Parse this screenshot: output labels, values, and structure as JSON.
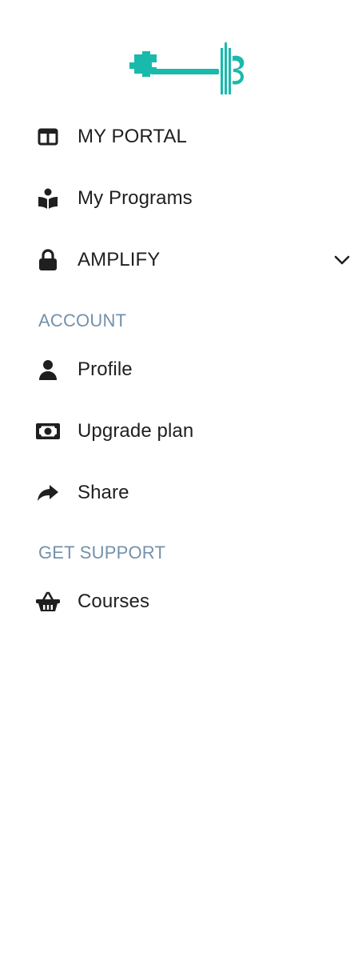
{
  "brand": {
    "logo_icon": "key-music-logo-icon",
    "logo_color": "#19b9ac"
  },
  "nav": {
    "primary": [
      {
        "label": "MY PORTAL",
        "icon": "columns-icon"
      },
      {
        "label": "My Programs",
        "icon": "reader-icon"
      },
      {
        "label": "AMPLIFY",
        "icon": "lock-icon",
        "expandable": true,
        "expand_icon": "chevron-down-icon"
      }
    ],
    "sections": [
      {
        "heading": "ACCOUNT",
        "items": [
          {
            "label": "Profile",
            "icon": "user-icon"
          },
          {
            "label": "Upgrade plan",
            "icon": "money-bill-icon"
          },
          {
            "label": "Share",
            "icon": "share-arrow-icon"
          }
        ]
      },
      {
        "heading": "GET SUPPORT",
        "items": [
          {
            "label": "Courses",
            "icon": "basket-icon"
          }
        ]
      }
    ]
  },
  "colors": {
    "text": "#1f1f1f",
    "section_heading": "#7391ab",
    "background": "#ffffff"
  }
}
